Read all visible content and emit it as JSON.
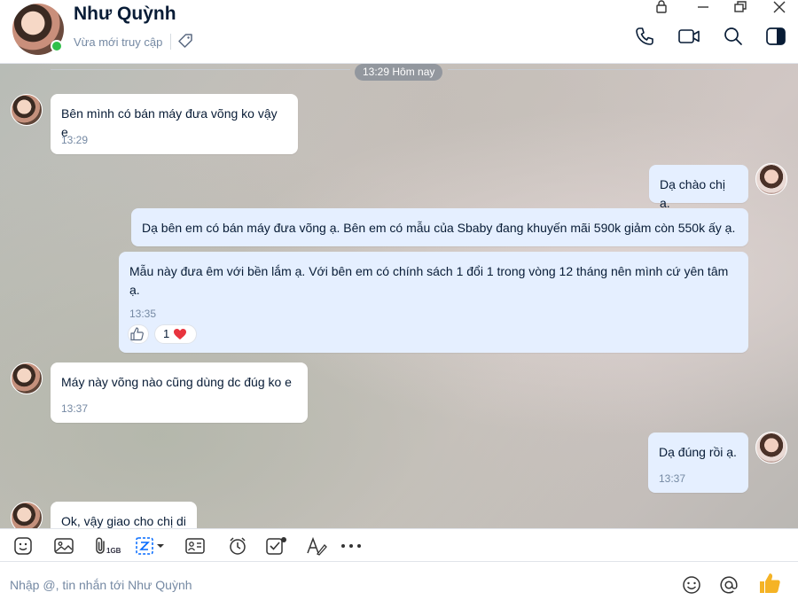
{
  "header": {
    "contact_name": "Như Quỳnh",
    "status": "Vừa mới truy cập"
  },
  "chat": {
    "date_divider": "13:29 Hôm nay",
    "messages": [
      {
        "direction": "in",
        "text": "Bên mình có bán máy đưa võng ko vậy e",
        "time": "13:29"
      },
      {
        "direction": "out",
        "text": "Dạ chào chị ạ."
      },
      {
        "direction": "out",
        "text": "Dạ bên em có bán máy đưa võng ạ. Bên em có mẫu của Sbaby đang khuyến mãi 590k giảm còn 550k ấy ạ."
      },
      {
        "direction": "out",
        "text": "Mẫu này đưa êm với bền lắm ạ. Với bên em có chính sách 1 đổi 1 trong vòng 12 tháng nên mình cứ yên tâm ạ.",
        "time": "13:35",
        "reaction_count": "1"
      },
      {
        "direction": "in",
        "text": "Máy này võng nào cũng dùng dc đúg ko e",
        "time": "13:37"
      },
      {
        "direction": "out",
        "text": "Dạ đúng rồi ạ.",
        "time": "13:37"
      },
      {
        "direction": "in",
        "text": "Ok, vậy giao cho chị di"
      }
    ]
  },
  "toolbar": {
    "file_size_label": "1GB",
    "icons": [
      "sticker-icon",
      "image-icon",
      "attach-icon",
      "screenshot-icon",
      "contact-card-icon",
      "reminder-icon",
      "task-icon",
      "format-text-icon",
      "more-icon"
    ]
  },
  "composer": {
    "placeholder": "Nhập @, tin nhắn tới Như Quỳnh"
  },
  "colors": {
    "accent": "#0068ff",
    "outgoing_bubble": "#e5efff",
    "incoming_bubble": "#ffffff",
    "online": "#30c04a",
    "heart": "#e8343e",
    "like": "#f5b325"
  }
}
